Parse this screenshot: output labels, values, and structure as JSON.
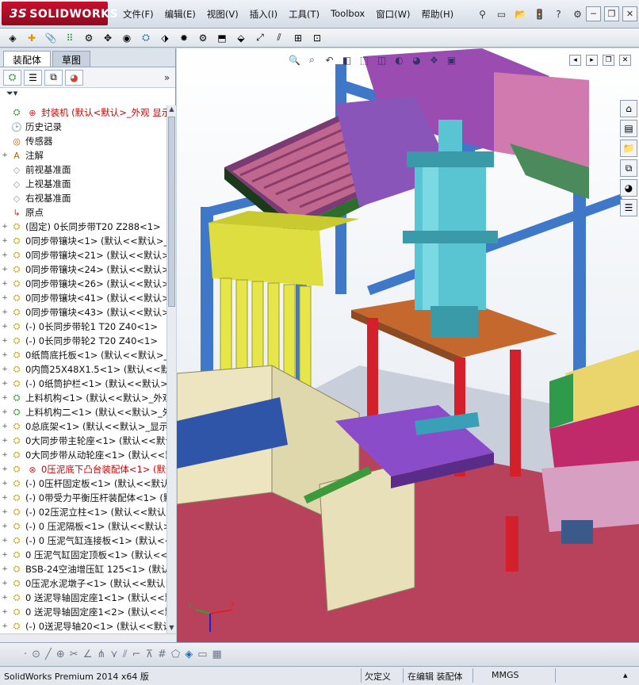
{
  "app": {
    "logo_brand": "SOLIDWORKS",
    "logo_prefix": "3S"
  },
  "menubar": [
    {
      "name": "menu-file",
      "label": "文件(F)"
    },
    {
      "name": "menu-edit",
      "label": "编辑(E)"
    },
    {
      "name": "menu-view",
      "label": "视图(V)"
    },
    {
      "name": "menu-insert",
      "label": "插入(I)"
    },
    {
      "name": "menu-tools",
      "label": "工具(T)"
    },
    {
      "name": "menu-toolbox",
      "label": "Toolbox"
    },
    {
      "name": "menu-window",
      "label": "窗口(W)"
    },
    {
      "name": "menu-help",
      "label": "帮助(H)"
    }
  ],
  "panel": {
    "tab_assembly": "装配体",
    "tab_sketch": "草图",
    "tree": [
      {
        "label": "封装机  (默认<默认>_外观 显示状态-1>)",
        "icon": "assembly",
        "expand": "",
        "red": true,
        "alert": true
      },
      {
        "label": "历史记录",
        "icon": "history",
        "expand": ""
      },
      {
        "label": "传感器",
        "icon": "sensor",
        "expand": ""
      },
      {
        "label": "注解",
        "icon": "annotation",
        "expand": "+"
      },
      {
        "label": "前视基准面",
        "icon": "plane",
        "expand": ""
      },
      {
        "label": "上视基准面",
        "icon": "plane",
        "expand": ""
      },
      {
        "label": "右视基准面",
        "icon": "plane",
        "expand": ""
      },
      {
        "label": "原点",
        "icon": "origin",
        "expand": ""
      },
      {
        "label": "(固定) 0长同步带T20 Z288<1>",
        "icon": "part",
        "expand": "+"
      },
      {
        "label": "0同步带镶块<1> (默认<<默认>_外观",
        "icon": "part",
        "expand": "+"
      },
      {
        "label": "0同步带镶块<21> (默认<<默认>_外观",
        "icon": "part",
        "expand": "+"
      },
      {
        "label": "0同步带镶块<24> (默认<<默认>_外观",
        "icon": "part",
        "expand": "+"
      },
      {
        "label": "0同步带镶块<26> (默认<<默认>_外观",
        "icon": "part",
        "expand": "+"
      },
      {
        "label": "0同步带镶块<41> (默认<<默认>_外观",
        "icon": "part",
        "expand": "+"
      },
      {
        "label": "0同步带镶块<43> (默认<<默认>_外观",
        "icon": "part",
        "expand": "+"
      },
      {
        "label": "(-) 0长同步带轮1 T20 Z40<1>",
        "icon": "part",
        "expand": "+"
      },
      {
        "label": "(-) 0长同步带轮2 T20 Z40<1>",
        "icon": "part",
        "expand": "+"
      },
      {
        "label": "0纸筒底托板<1> (默认<<默认>_外观",
        "icon": "part",
        "expand": "+"
      },
      {
        "label": "0内筒25X48X1.5<1> (默认<<默认>_外观",
        "icon": "part",
        "expand": "+"
      },
      {
        "label": "(-) 0纸筒护栏<1> (默认<<默认>_外观",
        "icon": "part",
        "expand": "+"
      },
      {
        "label": "上料机构<1> (默认<<默认>_外观",
        "icon": "subasm",
        "expand": "+"
      },
      {
        "label": "上料机构二<1> (默认<<默认>_外观",
        "icon": "subasm",
        "expand": "+"
      },
      {
        "label": "0总底架<1> (默认<<默认>_显示",
        "icon": "part",
        "expand": "+"
      },
      {
        "label": "0大同步带主轮座<1> (默认<<默认>_外观",
        "icon": "part",
        "expand": "+"
      },
      {
        "label": "0大同步带从动轮座<1> (默认<<默认>_外观",
        "icon": "part",
        "expand": "+"
      },
      {
        "label": "0压泥底下凸台装配体<1> (默认<<默认>_外观",
        "icon": "part",
        "expand": "+",
        "red": true,
        "error": true
      },
      {
        "label": "(-) 0压杆固定板<1> (默认<<默认>_外观",
        "icon": "part",
        "expand": "+"
      },
      {
        "label": "(-) 0带受力平衡压杆装配体<1> (默认",
        "icon": "part",
        "expand": "+"
      },
      {
        "label": "(-) 02压泥立柱<1> (默认<<默认>_外观",
        "icon": "part",
        "expand": "+"
      },
      {
        "label": "(-) 0 压泥隔板<1> (默认<<默认>_外观",
        "icon": "part",
        "expand": "+"
      },
      {
        "label": "(-) 0 压泥气缸连接板<1> (默认<<默认",
        "icon": "part",
        "expand": "+"
      },
      {
        "label": "0 压泥气缸固定顶板<1> (默认<<默认",
        "icon": "part",
        "expand": "+"
      },
      {
        "label": "BSB-24空油增压缸 125<1> (默认<<默认",
        "icon": "part",
        "expand": "+"
      },
      {
        "label": "0压泥水泥墩子<1> (默认<<默认>_外观",
        "icon": "part",
        "expand": "+"
      },
      {
        "label": "0 送泥导轴固定座1<1> (默认<<默认",
        "icon": "part",
        "expand": "+"
      },
      {
        "label": "0 送泥导轴固定座1<2> (默认<<默认",
        "icon": "part",
        "expand": "+"
      },
      {
        "label": "(-) 0送泥导轴20<1> (默认<<默认>_外观",
        "icon": "part",
        "expand": "+"
      }
    ]
  },
  "status": {
    "app_version": "SolidWorks Premium 2014 x64 版",
    "underdefined": "欠定义",
    "editing": "在编辑 装配体",
    "units": "MMGS"
  },
  "colors": {
    "logo_red": "#c8102e",
    "panel_bg": "#ffffff",
    "frame_blue": "#3f77c9",
    "floor_red": "#b8415b"
  }
}
